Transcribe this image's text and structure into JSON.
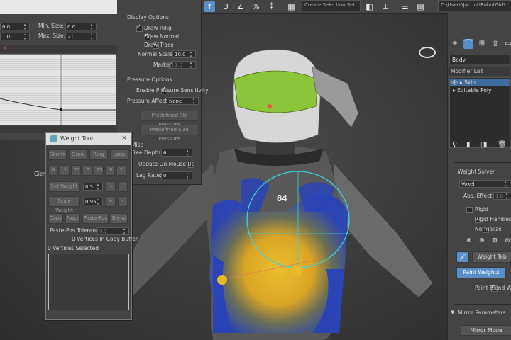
{
  "toolbar": {
    "selection_set_placeholder": "Create Selection Set",
    "path": "C:\\Users\\Jai...ut\\RobotGirl\\"
  },
  "skin_params": {
    "min_size_label": "Min. Size:",
    "min_size_value": "0.0",
    "min_size_left": "0.0",
    "max_size_label": "Max. Size:",
    "max_size_value": "21.1",
    "max_size_left": "1.0",
    "close_x": "x",
    "gizmo_label": "Gizm",
    "display_options_label": "Display Options",
    "draw_ring": "Draw Ring",
    "draw_normal": "Draw Normal",
    "draw_trace": "Draw Trace",
    "normal_scale_label": "Normal Scale:",
    "normal_scale_value": "10.0",
    "marker_label": "Marker",
    "marker_value": "1.0",
    "pressure_options_label": "Pressure Options",
    "enable_pressure": "Enable Pressure Sensitivity",
    "pressure_affects_label": "Pressure Affects",
    "pressure_affects_value": "None",
    "predefined_str": "Predefined Str Pressure",
    "predefined_size": "Predefined Size Pressure",
    "misc_label": "Misc",
    "tree_depth_label": "Tree Depth:",
    "tree_depth_value": "6",
    "update_mouse_up": "Update On Mouse Up",
    "lag_rate_label": "Lag Rate:",
    "lag_rate_value": "0"
  },
  "weight_tool": {
    "title": "Weight Tool",
    "shrink": "Shrink",
    "grow": "Grow",
    "ring": "Ring",
    "loop": "Loop",
    "presets": [
      "0",
      ".1",
      ".25",
      ".5",
      ".75",
      ".9",
      "1"
    ],
    "set_weight": "Set Weight",
    "set_weight_value": "0.5",
    "scale_weight": "Scale Weight",
    "scale_weight_value": "0.95",
    "plus": "+",
    "minus": "-",
    "copy": "Copy",
    "paste": "Paste",
    "paste_pos": "Paste-Pos",
    "blend": "Blend",
    "paste_pos_tol_label": "Paste-Pos Tolerance",
    "paste_pos_tol_value": "0.1",
    "vertices_in_buffer": "0 Vertices In Copy Buffer",
    "vertices_selected": "0 Vertices Selected"
  },
  "command_panel": {
    "object_name": "Body",
    "modifier_list": "Modifier List",
    "stack": [
      "Skin",
      "Editable Poly"
    ],
    "weight_solver": "Weight Solver",
    "solver_type": "Voxel",
    "abs_effect_label": "Abs. Effect:",
    "abs_effect_value": "1.0",
    "rigid": "Rigid",
    "rigid_handles": "Rigid Handles",
    "normalize": "Normalize",
    "weight_table": "Weight Tab",
    "paint_weights": "Paint Weights",
    "paint_blend": "Paint Blend Weig",
    "mirror_parameters": "Mirror Parameters",
    "mirror_mode": "Mirror Mode"
  },
  "viewport": {
    "model_text": "84",
    "colors": {
      "heat_yellow": "#e0b422",
      "heat_blue": "#1f3fb0",
      "envelope": "#3fd0e0",
      "helmet_green": "#8cc43a"
    }
  }
}
